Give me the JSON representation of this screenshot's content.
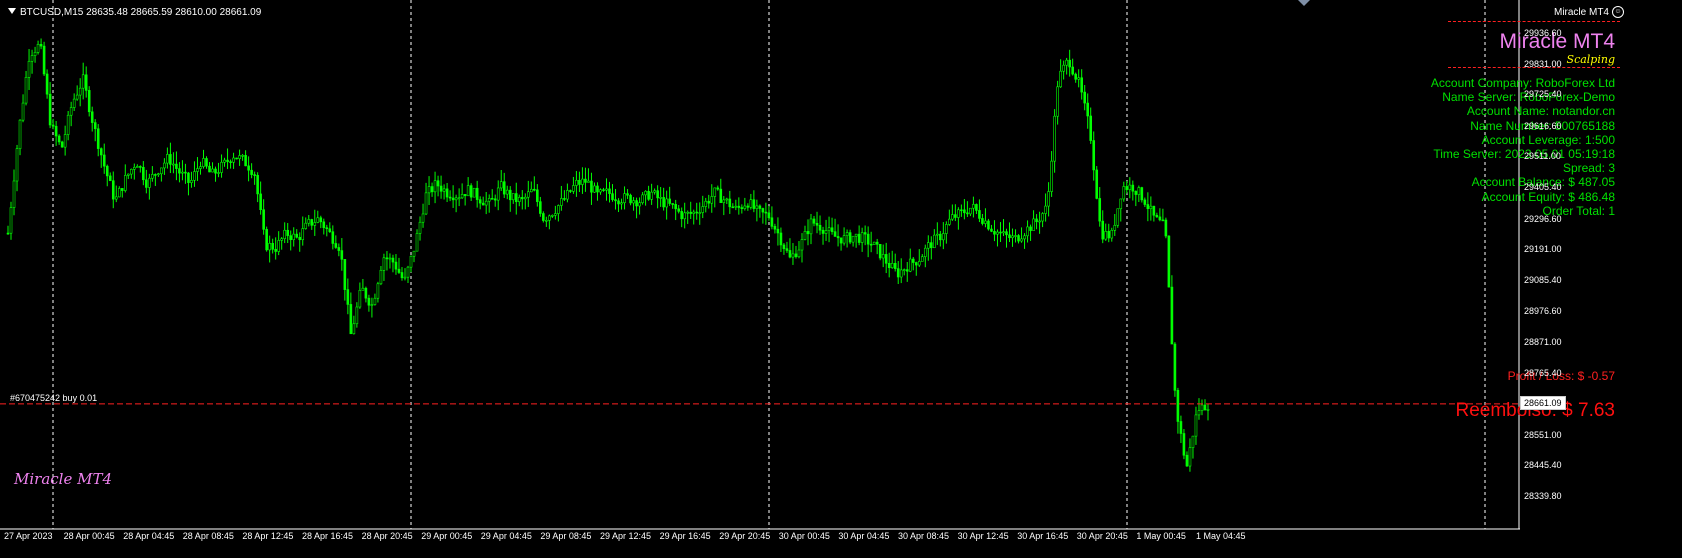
{
  "header": {
    "symbol_info": "BTCUSD,M15  28635.48 28665.59 28610.00 28661.09"
  },
  "ea": {
    "name": "Miracle MT4"
  },
  "panel": {
    "title": "Miracle MT4",
    "subtitle": "Scalping",
    "info_lines": [
      "Account Company: RoboForex Ltd",
      "Name Server: RoboForex-Demo",
      "Account Name: notandor.cn",
      "Name Number: 500765188",
      "Account Leverage: 1:500",
      "Time Server: 2023.05.01 05:19:18",
      "Spread: 3",
      "Account Balance: $ 487.05",
      "Account Equity: $ 486.48",
      "Order Total: 1"
    ],
    "profit_loss": "Profit / Loss: $ -0.57",
    "reembolso": "Reembolso: $ 7.63"
  },
  "order_line": {
    "label": "#670475242 buy 0.01"
  },
  "watermark": "Miracle MT4",
  "current_price": "28661.09",
  "y_axis": [
    "29936.60",
    "29831.00",
    "29725.40",
    "29616.60",
    "29511.00",
    "29405.40",
    "29296.60",
    "29191.00",
    "29085.40",
    "28976.60",
    "28871.00",
    "28765.40",
    "28551.00",
    "28445.40",
    "28339.80"
  ],
  "x_axis": [
    "27 Apr 2023",
    "28 Apr 00:45",
    "28 Apr 04:45",
    "28 Apr 08:45",
    "28 Apr 12:45",
    "28 Apr 16:45",
    "28 Apr 20:45",
    "29 Apr 00:45",
    "29 Apr 04:45",
    "29 Apr 08:45",
    "29 Apr 12:45",
    "29 Apr 16:45",
    "29 Apr 20:45",
    "30 Apr 00:45",
    "30 Apr 04:45",
    "30 Apr 08:45",
    "30 Apr 12:45",
    "30 Apr 16:45",
    "30 Apr 20:45",
    "1 May 00:45",
    "1 May 04:45"
  ],
  "colors": {
    "candle": "#00ff00",
    "background": "#000000",
    "grid": "#ffffff",
    "price_line": "#ff2020",
    "axis": "#ffffff"
  },
  "chart_data": {
    "type": "candlestick",
    "price_range": [
      28339.8,
      29990
    ],
    "series": [
      {
        "values": [
          29250,
          29600,
          29870,
          29900,
          29620,
          29540,
          29700,
          29780,
          29620,
          29480,
          29360,
          29440,
          29500,
          29420,
          29470,
          29510,
          29460,
          29420,
          29500,
          29450,
          29480,
          29520,
          29500,
          29460,
          29210,
          29200,
          29250,
          29230,
          29280,
          29300,
          29250,
          29200,
          28900,
          29060,
          29000,
          29170,
          29150,
          29080,
          29210,
          29380,
          29420,
          29390,
          29380,
          29400,
          29370,
          29350,
          29410,
          29370,
          29360,
          29400,
          29300,
          29330,
          29370,
          29420,
          29430,
          29380,
          29390,
          29370,
          29370,
          29360,
          29390,
          29360,
          29340,
          29310,
          29320,
          29350,
          29390,
          29360,
          29330,
          29360,
          29320,
          29310,
          29240,
          29160,
          29210,
          29290,
          29270,
          29240,
          29230,
          29240,
          29230,
          29200,
          29150,
          29110,
          29140,
          29160,
          29210,
          29240,
          29300,
          29320,
          29340,
          29300,
          29260,
          29240,
          29230,
          29260,
          29290,
          29340,
          29780,
          29850,
          29760,
          29600,
          29250,
          29240,
          29410,
          29410,
          29370,
          29300,
          29270,
          28650,
          28440,
          28640,
          28661
        ]
      }
    ]
  }
}
